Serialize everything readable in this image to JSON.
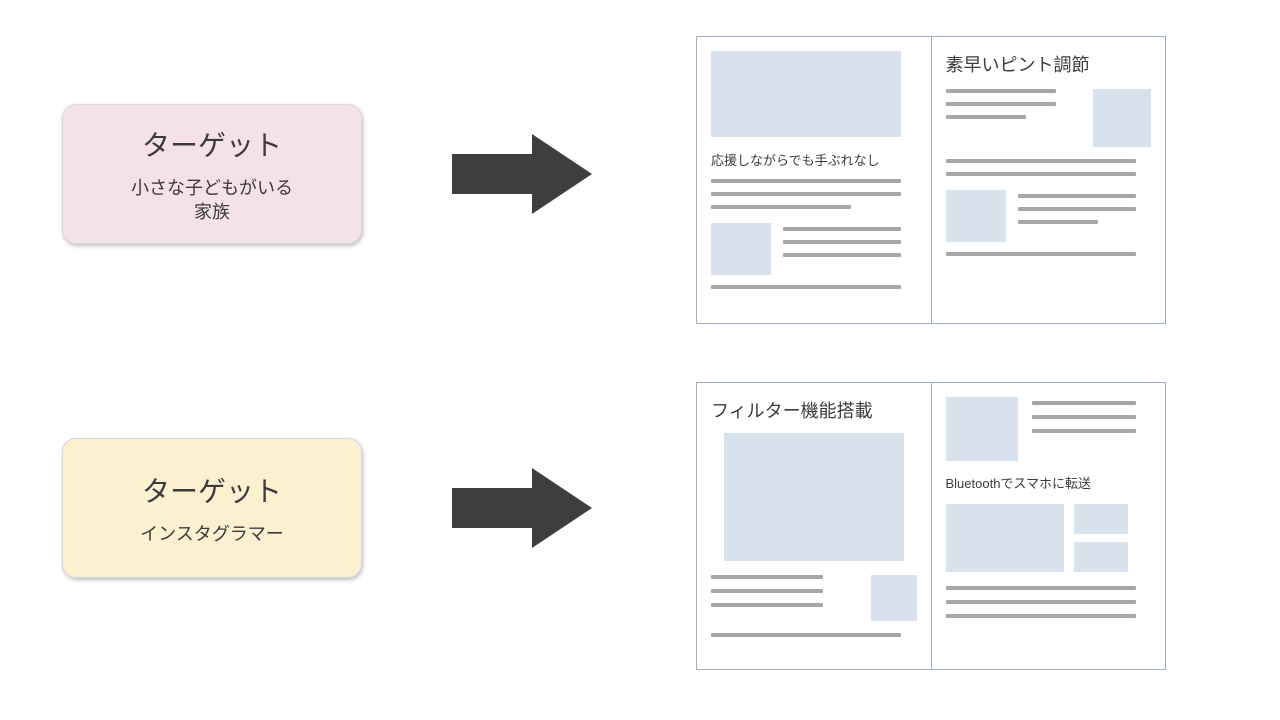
{
  "rows": [
    {
      "box_class": "target-pink",
      "title": "ターゲット",
      "subtitle": "小さな子どもがいる\n家族",
      "page_left": {
        "text": "応援しながらでも手ぶれなし"
      },
      "page_right": {
        "text": "素早いピント調節"
      }
    },
    {
      "box_class": "target-yellow",
      "title": "ターゲット",
      "subtitle": "インスタグラマー",
      "page_left": {
        "text": "フィルター機能搭載"
      },
      "page_right": {
        "text": "Bluetoothでスマホに転送"
      }
    }
  ],
  "colors": {
    "arrow": "#3e3e3e",
    "image_placeholder": "#d8e2ec",
    "text_line": "#a7a7a7",
    "page_border": "#a0b0c4"
  }
}
